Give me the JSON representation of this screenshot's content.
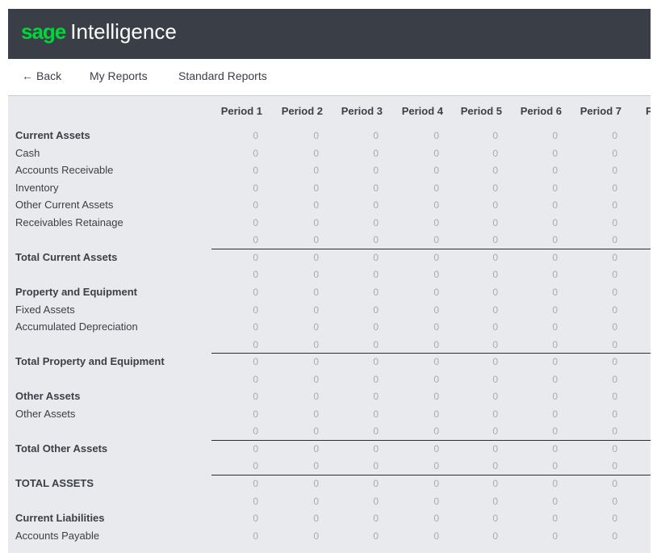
{
  "header": {
    "brand": "sage",
    "product": "Intelligence",
    "background": "#3a3e46",
    "brand_color": "#00d639"
  },
  "nav": {
    "back_label": "Back",
    "back_icon": "arrow-left-icon",
    "my_reports_label": "My Reports",
    "standard_reports_label": "Standard Reports"
  },
  "report": {
    "columns": [
      "Period 1",
      "Period 2",
      "Period 3",
      "Period 4",
      "Period 5",
      "Period 6",
      "Period 7",
      "P"
    ],
    "rows": [
      {
        "label": "Current Assets",
        "bold": true,
        "values": [
          "0",
          "0",
          "0",
          "0",
          "0",
          "0",
          "0"
        ]
      },
      {
        "label": "Cash",
        "bold": false,
        "values": [
          "0",
          "0",
          "0",
          "0",
          "0",
          "0",
          "0"
        ]
      },
      {
        "label": "Accounts Receivable",
        "bold": false,
        "values": [
          "0",
          "0",
          "0",
          "0",
          "0",
          "0",
          "0"
        ]
      },
      {
        "label": "Inventory",
        "bold": false,
        "values": [
          "0",
          "0",
          "0",
          "0",
          "0",
          "0",
          "0"
        ]
      },
      {
        "label": "Other Current Assets",
        "bold": false,
        "values": [
          "0",
          "0",
          "0",
          "0",
          "0",
          "0",
          "0"
        ]
      },
      {
        "label": "Receivables Retainage",
        "bold": false,
        "values": [
          "0",
          "0",
          "0",
          "0",
          "0",
          "0",
          "0"
        ]
      },
      {
        "label": "",
        "bold": false,
        "values": [
          "0",
          "0",
          "0",
          "0",
          "0",
          "0",
          "0"
        ]
      },
      {
        "label": "Total Current Assets",
        "bold": true,
        "total": true,
        "values": [
          "0",
          "0",
          "0",
          "0",
          "0",
          "0",
          "0"
        ]
      },
      {
        "label": "",
        "bold": false,
        "values": [
          "0",
          "0",
          "0",
          "0",
          "0",
          "0",
          "0"
        ]
      },
      {
        "label": "Property and Equipment",
        "bold": true,
        "values": [
          "0",
          "0",
          "0",
          "0",
          "0",
          "0",
          "0"
        ]
      },
      {
        "label": "Fixed Assets",
        "bold": false,
        "values": [
          "0",
          "0",
          "0",
          "0",
          "0",
          "0",
          "0"
        ]
      },
      {
        "label": "Accumulated Depreciation",
        "bold": false,
        "values": [
          "0",
          "0",
          "0",
          "0",
          "0",
          "0",
          "0"
        ]
      },
      {
        "label": "",
        "bold": false,
        "values": [
          "0",
          "0",
          "0",
          "0",
          "0",
          "0",
          "0"
        ]
      },
      {
        "label": "Total Property and Equipment",
        "bold": true,
        "total": true,
        "values": [
          "0",
          "0",
          "0",
          "0",
          "0",
          "0",
          "0"
        ]
      },
      {
        "label": "",
        "bold": false,
        "values": [
          "0",
          "0",
          "0",
          "0",
          "0",
          "0",
          "0"
        ]
      },
      {
        "label": "Other Assets",
        "bold": true,
        "values": [
          "0",
          "0",
          "0",
          "0",
          "0",
          "0",
          "0"
        ]
      },
      {
        "label": "Other Assets",
        "bold": false,
        "values": [
          "0",
          "0",
          "0",
          "0",
          "0",
          "0",
          "0"
        ]
      },
      {
        "label": "",
        "bold": false,
        "values": [
          "0",
          "0",
          "0",
          "0",
          "0",
          "0",
          "0"
        ]
      },
      {
        "label": "Total Other Assets",
        "bold": true,
        "total": true,
        "values": [
          "0",
          "0",
          "0",
          "0",
          "0",
          "0",
          "0"
        ]
      },
      {
        "label": "",
        "bold": false,
        "values": [
          "0",
          "0",
          "0",
          "0",
          "0",
          "0",
          "0"
        ]
      },
      {
        "label": "TOTAL ASSETS",
        "bold": true,
        "total": true,
        "values": [
          "0",
          "0",
          "0",
          "0",
          "0",
          "0",
          "0"
        ]
      },
      {
        "label": "",
        "bold": false,
        "values": [
          "0",
          "0",
          "0",
          "0",
          "0",
          "0",
          "0"
        ]
      },
      {
        "label": "Current Liabilities",
        "bold": true,
        "values": [
          "0",
          "0",
          "0",
          "0",
          "0",
          "0",
          "0"
        ]
      },
      {
        "label": "Accounts Payable",
        "bold": false,
        "values": [
          "0",
          "0",
          "0",
          "0",
          "0",
          "0",
          "0"
        ]
      }
    ]
  }
}
